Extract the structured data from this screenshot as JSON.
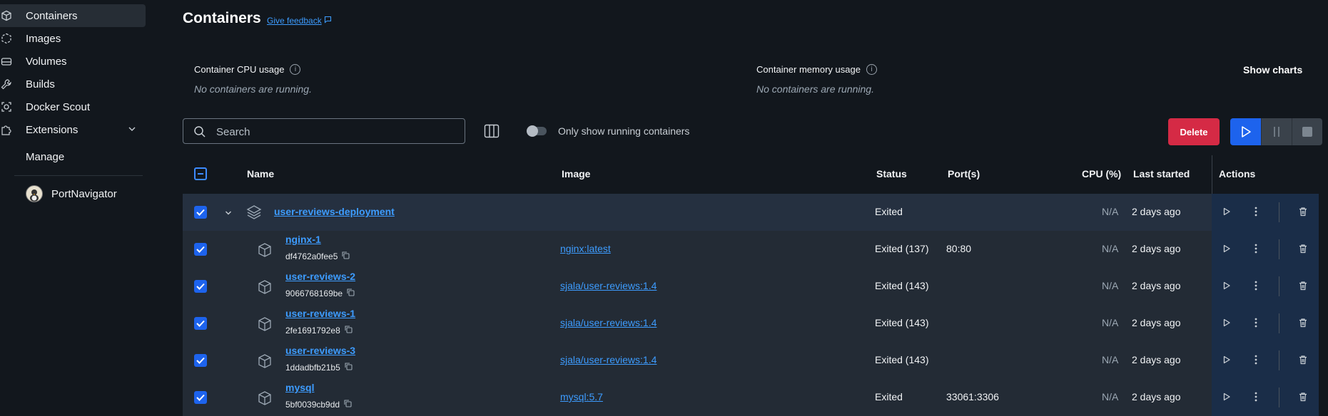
{
  "sidebar": {
    "items": [
      {
        "label": "Containers",
        "icon": "container-icon",
        "active": true
      },
      {
        "label": "Images",
        "icon": "images-icon"
      },
      {
        "label": "Volumes",
        "icon": "volumes-icon"
      },
      {
        "label": "Builds",
        "icon": "builds-icon"
      },
      {
        "label": "Docker Scout",
        "icon": "scout-icon"
      },
      {
        "label": "Extensions",
        "icon": "extensions-icon"
      },
      {
        "label": "Manage"
      }
    ],
    "extensions": [
      {
        "label": "PortNavigator",
        "icon": "portnavigator-avatar"
      }
    ]
  },
  "header": {
    "title": "Containers",
    "feedback": "Give feedback"
  },
  "stats": {
    "cpu_label": "Container CPU usage",
    "cpu_empty": "No containers are running.",
    "mem_label": "Container memory usage",
    "mem_empty": "No containers are running.",
    "show_charts": "Show charts"
  },
  "toolbar": {
    "search_placeholder": "Search",
    "toggle_label": "Only show running containers",
    "delete_label": "Delete"
  },
  "table": {
    "columns": {
      "name": "Name",
      "image": "Image",
      "status": "Status",
      "ports": "Port(s)",
      "cpu": "CPU (%)",
      "last_started": "Last started",
      "actions": "Actions"
    },
    "group": {
      "name": "user-reviews-deployment",
      "status": "Exited",
      "cpu": "N/A",
      "last_started": "2 days ago"
    },
    "rows": [
      {
        "name": "nginx-1",
        "id": "df4762a0fee5",
        "image": "nginx:latest",
        "status": "Exited (137)",
        "ports": "80:80",
        "cpu": "N/A",
        "last_started": "2 days ago"
      },
      {
        "name": "user-reviews-2",
        "id": "9066768169be",
        "image": "sjala/user-reviews:1.4",
        "status": "Exited (143)",
        "ports": "",
        "cpu": "N/A",
        "last_started": "2 days ago"
      },
      {
        "name": "user-reviews-1",
        "id": "2fe1691792e8",
        "image": "sjala/user-reviews:1.4",
        "status": "Exited (143)",
        "ports": "",
        "cpu": "N/A",
        "last_started": "2 days ago"
      },
      {
        "name": "user-reviews-3",
        "id": "1ddadbfb21b5",
        "image": "sjala/user-reviews:1.4",
        "status": "Exited (143)",
        "ports": "",
        "cpu": "N/A",
        "last_started": "2 days ago"
      },
      {
        "name": "mysql",
        "id": "5bf0039cb9dd",
        "image": "mysql:5.7",
        "status": "Exited",
        "ports": "33061:3306",
        "cpu": "N/A",
        "last_started": "2 days ago"
      }
    ]
  },
  "colors": {
    "accent": "#1d63ed",
    "link": "#3d9cff",
    "danger": "#d52a45",
    "background": "#12171d",
    "row": "#232b35"
  }
}
